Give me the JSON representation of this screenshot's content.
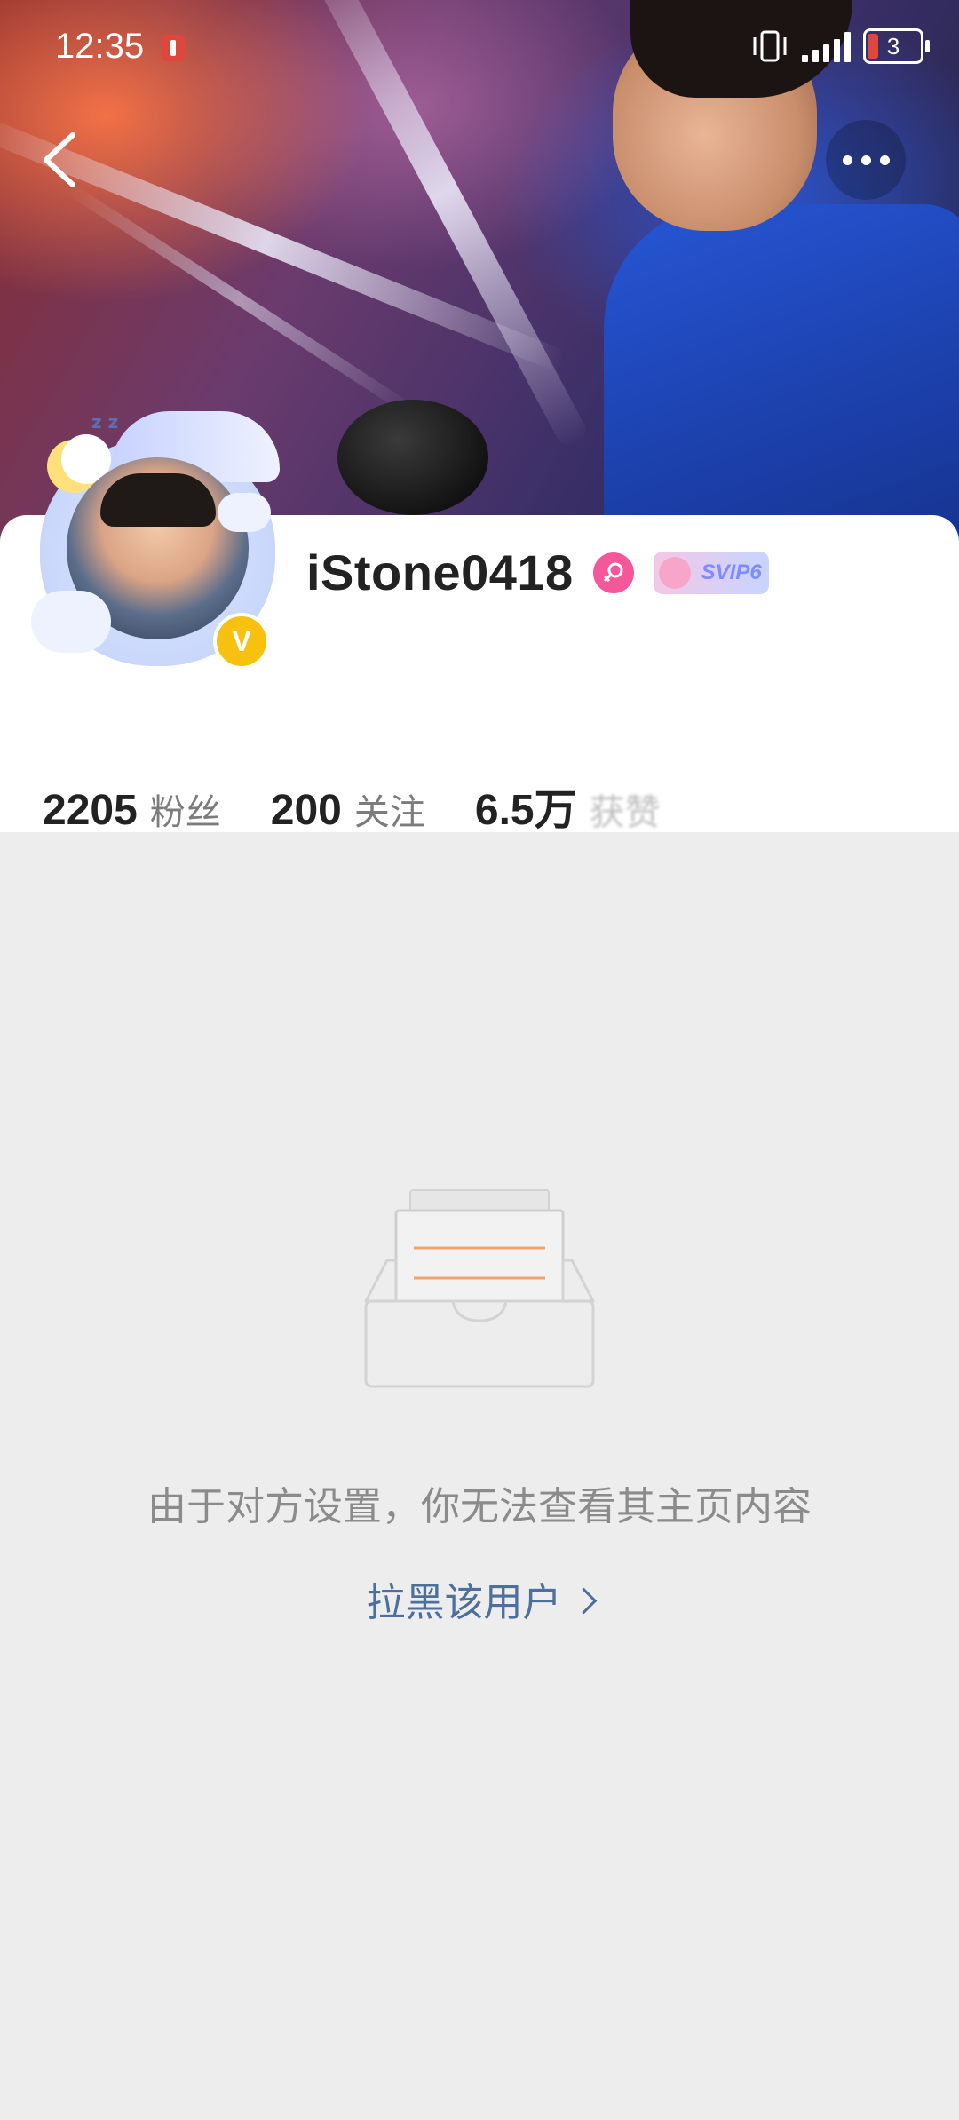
{
  "status_bar": {
    "time": "12:35",
    "battery_level": "3"
  },
  "header": {
    "back_icon": "chevron-left-icon",
    "more_icon": "more-dots-icon"
  },
  "profile": {
    "username": "iStone0418",
    "gender_icon": "female-icon",
    "vip_badge": "SVIP6",
    "verified_badge": "V",
    "stats": [
      {
        "value": "2205",
        "label": "粉丝"
      },
      {
        "value": "200",
        "label": "关注"
      },
      {
        "value": "6.5万",
        "label": "获赞"
      }
    ]
  },
  "empty_state": {
    "message": "由于对方设置，你无法查看其主页内容",
    "block_link": "拉黑该用户"
  },
  "colors": {
    "accent_link": "#4d6f9c",
    "background": "#ededed",
    "verified": "#f6c20f",
    "gender": "#f4589a"
  }
}
